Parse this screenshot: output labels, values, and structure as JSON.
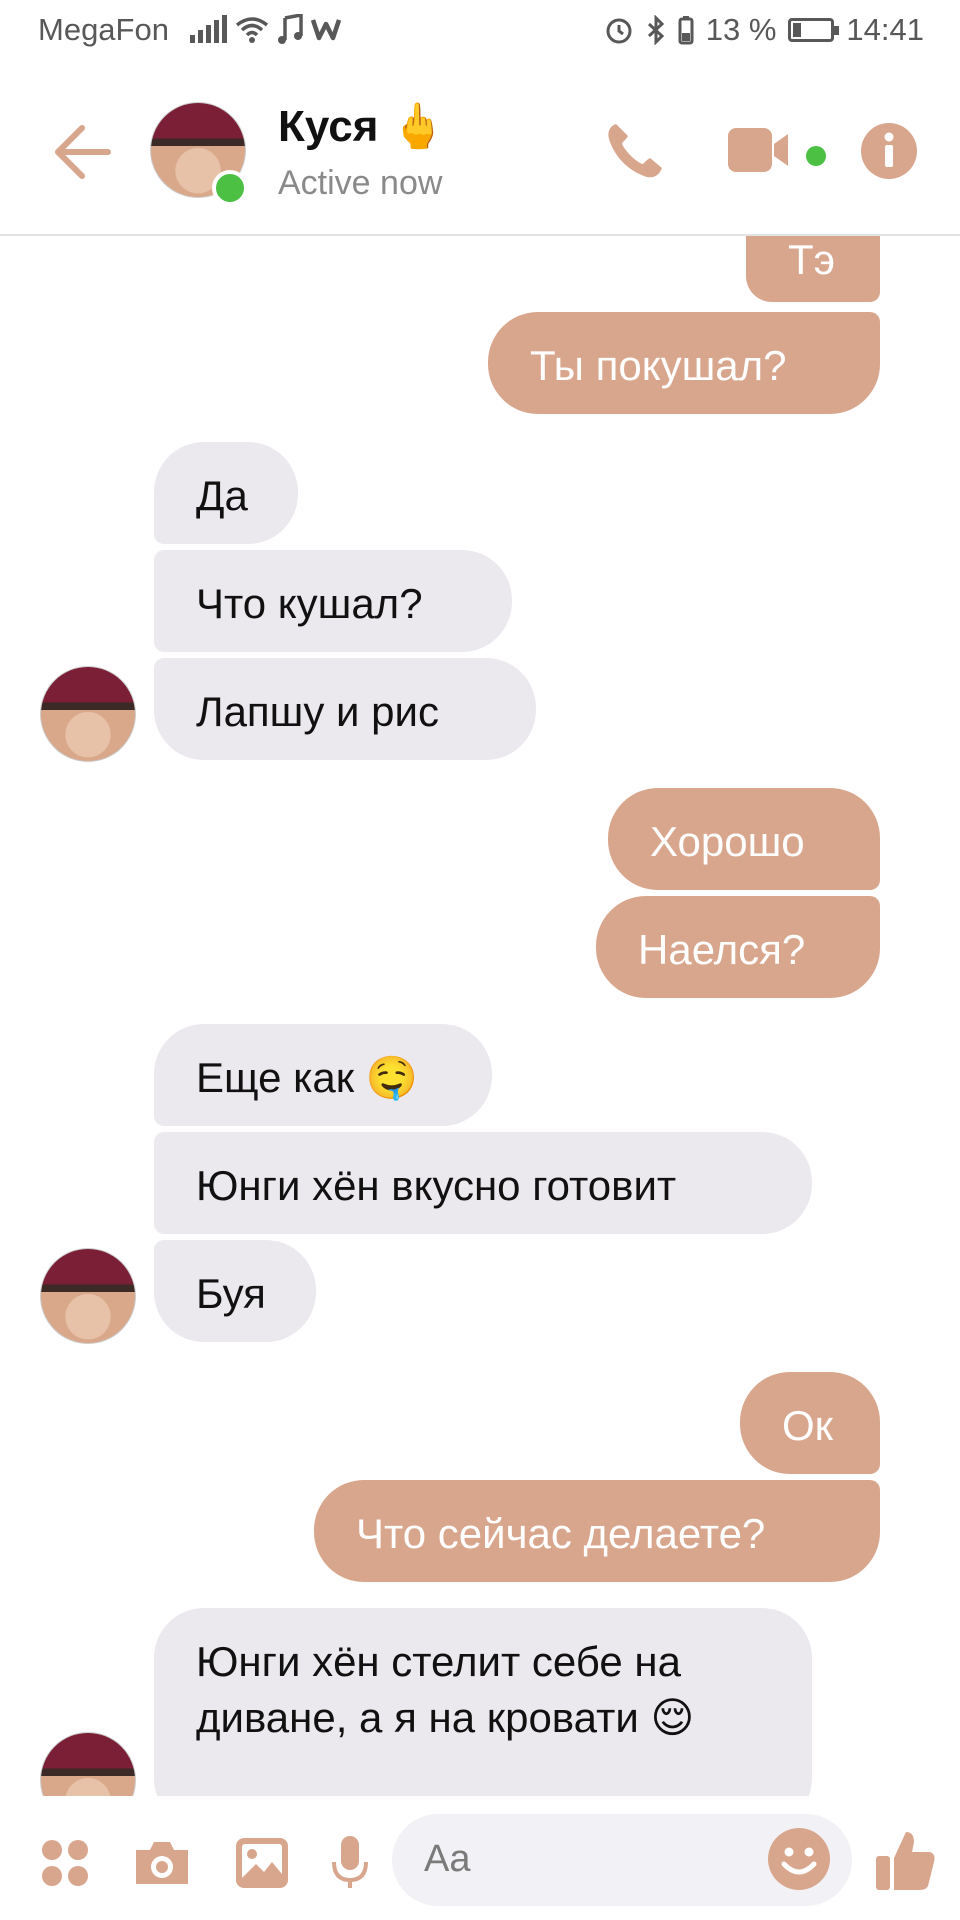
{
  "status_bar": {
    "carrier": "MegaFon",
    "battery": "13 %",
    "time": "14:41"
  },
  "header": {
    "contact_name": "Куся",
    "name_emoji": "🖕",
    "status": "Active now"
  },
  "messages": [
    {
      "dir": "out",
      "text": "Тэ"
    },
    {
      "dir": "out",
      "text": "Ты покушал?"
    },
    {
      "dir": "in",
      "text": "Да"
    },
    {
      "dir": "in",
      "text": "Что кушал?"
    },
    {
      "dir": "in",
      "text": "Лапшу и рис"
    },
    {
      "dir": "out",
      "text": "Хорошо"
    },
    {
      "dir": "out",
      "text": "Наелся?"
    },
    {
      "dir": "in",
      "text": "Еще как 🤤"
    },
    {
      "dir": "in",
      "text": "Юнги хён вкусно готовит"
    },
    {
      "dir": "in",
      "text": "Буя"
    },
    {
      "dir": "out",
      "text": "Ок"
    },
    {
      "dir": "out",
      "text": "Что сейчас делаете?"
    },
    {
      "dir": "in",
      "text": "Юнги хён стелит себе на диване, а я на кровати 😌"
    }
  ],
  "composer": {
    "placeholder": "Aa"
  },
  "colors": {
    "accent": "#d8a68c",
    "incoming_bubble": "#ebe9ee",
    "online": "#4bc043"
  }
}
